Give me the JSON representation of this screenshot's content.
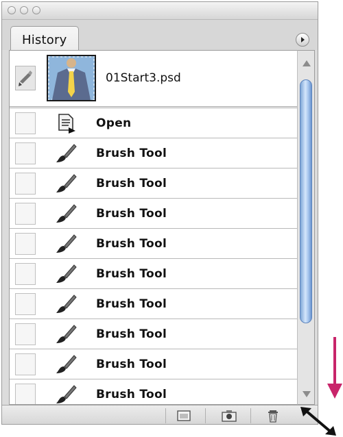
{
  "window": {
    "traffic_lights": [
      "close",
      "minimize",
      "zoom"
    ]
  },
  "panel": {
    "tab_label": "History",
    "snapshot_name": "01Start3.psd"
  },
  "history": {
    "items": [
      {
        "label": "Open",
        "icon": "open-document-icon"
      },
      {
        "label": "Brush Tool",
        "icon": "brush-icon"
      },
      {
        "label": "Brush Tool",
        "icon": "brush-icon"
      },
      {
        "label": "Brush Tool",
        "icon": "brush-icon"
      },
      {
        "label": "Brush Tool",
        "icon": "brush-icon"
      },
      {
        "label": "Brush Tool",
        "icon": "brush-icon"
      },
      {
        "label": "Brush Tool",
        "icon": "brush-icon"
      },
      {
        "label": "Brush Tool",
        "icon": "brush-icon"
      },
      {
        "label": "Brush Tool",
        "icon": "brush-icon"
      },
      {
        "label": "Brush Tool",
        "icon": "brush-icon"
      }
    ]
  },
  "bottom_bar": {
    "buttons": [
      "new-document-from-state-icon",
      "new-snapshot-icon",
      "trash-icon"
    ]
  },
  "annotations": {
    "accent_color": "#c8246a"
  }
}
